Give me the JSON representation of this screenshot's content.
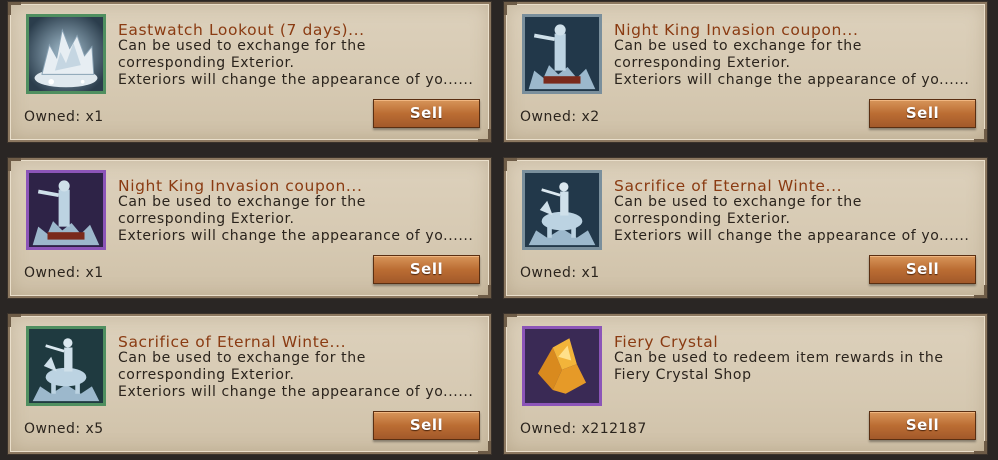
{
  "items": [
    {
      "title": "Eastwatch Lookout (7 days)...",
      "desc_lines": [
        "Can be used to exchange for the",
        "corresponding Exterior.",
        "Exteriors will change the appearance of yo......"
      ],
      "owned": "Owned: x1",
      "sell_label": "Sell",
      "icon": "ice-castle-icon",
      "rarity_color": "#4f8f60"
    },
    {
      "title": "Night King Invasion coupon...",
      "desc_lines": [
        "Can be used to exchange for the",
        "corresponding Exterior.",
        "Exteriors will change the appearance of yo......"
      ],
      "owned": "Owned: x2",
      "sell_label": "Sell",
      "icon": "night-king-statue-icon",
      "rarity_color": "#7a8f9c"
    },
    {
      "title": "Night King Invasion coupon...",
      "desc_lines": [
        "Can be used to exchange for the",
        "corresponding Exterior.",
        "Exteriors will change the appearance of yo......"
      ],
      "owned": "Owned: x1",
      "sell_label": "Sell",
      "icon": "night-king-statue-icon",
      "rarity_color": "#8c55b8"
    },
    {
      "title": "Sacrifice of Eternal Winte...",
      "desc_lines": [
        "Can be used to exchange for the",
        "corresponding Exterior.",
        "Exteriors will change the appearance of yo......"
      ],
      "owned": "Owned: x1",
      "sell_label": "Sell",
      "icon": "horse-rider-statue-icon",
      "rarity_color": "#7a8f9c"
    },
    {
      "title": "Sacrifice of Eternal Winte...",
      "desc_lines": [
        "Can be used to exchange for the",
        "corresponding Exterior.",
        "Exteriors will change the appearance of yo......"
      ],
      "owned": "Owned: x5",
      "sell_label": "Sell",
      "icon": "horse-rider-statue-icon",
      "rarity_color": "#4f8f60"
    },
    {
      "title": "Fiery Crystal",
      "desc_lines": [
        "Can be used to redeem item rewards in the",
        "Fiery Crystal Shop"
      ],
      "owned": "Owned: x212187",
      "sell_label": "Sell",
      "icon": "fiery-crystal-icon",
      "rarity_color": "#8c55b8"
    }
  ]
}
